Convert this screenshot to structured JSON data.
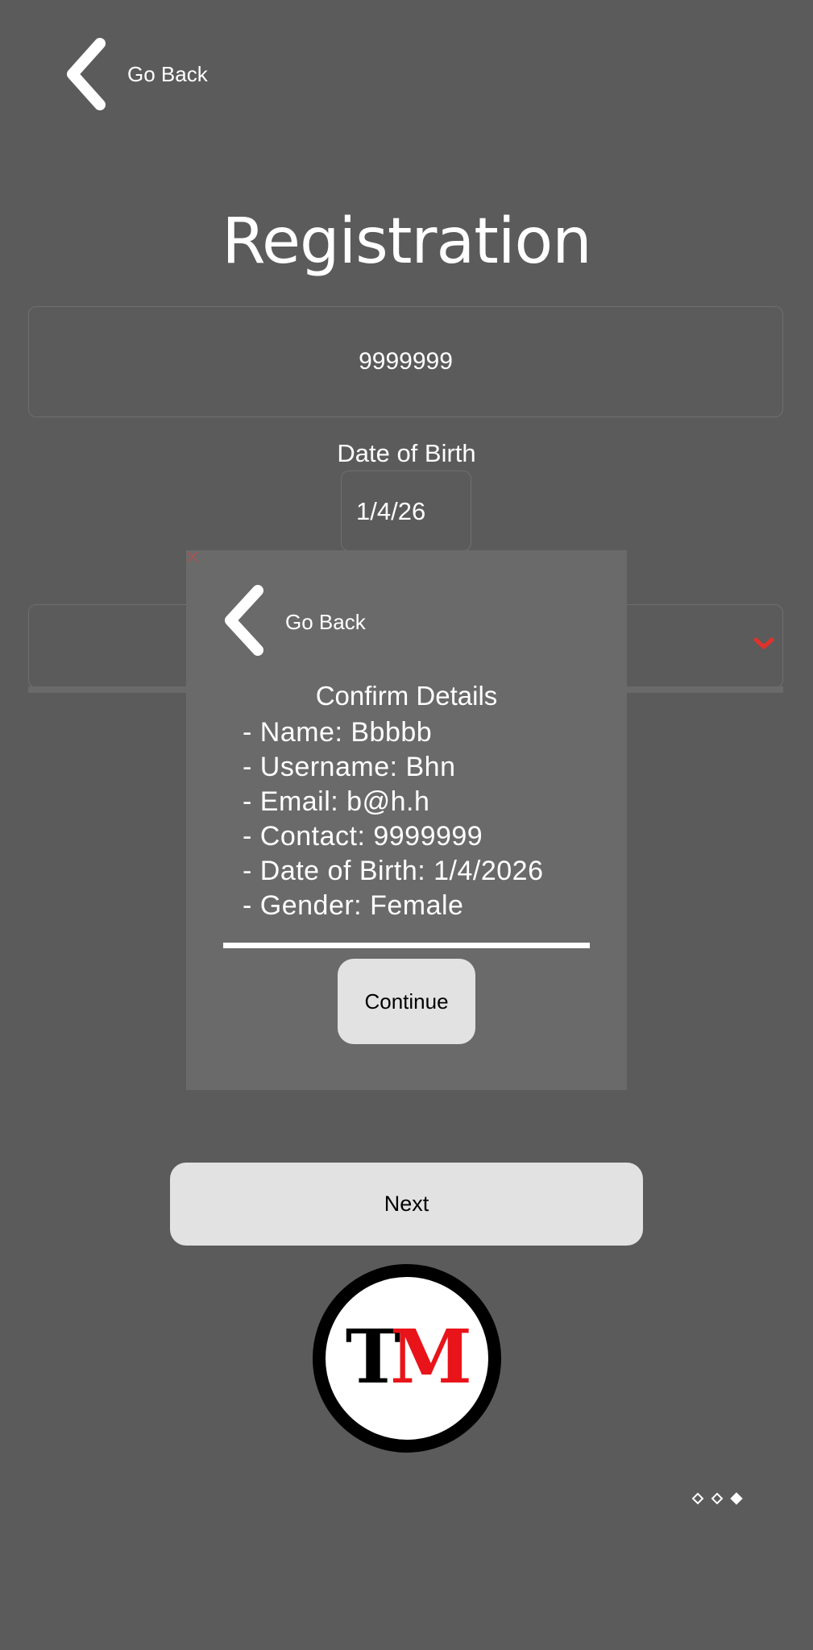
{
  "header": {
    "back_label": "Go Back"
  },
  "page": {
    "title": "Registration"
  },
  "form": {
    "contact_value": "9999999",
    "dob_label": "Date of Birth",
    "dob_value": "1/4/26",
    "gender_value": ""
  },
  "modal": {
    "back_label": "Go Back",
    "title": "Confirm Details",
    "details": [
      "- Name: Bbbbb",
      "- Username: Bhn",
      "- Email: b@h.h",
      "- Contact: 9999999",
      "- Date of Birth: 1/4/2026",
      "- Gender: Female"
    ],
    "continue_label": "Continue"
  },
  "actions": {
    "next_label": "Next"
  },
  "logo": {
    "letter_1": "T",
    "letter_2": "M"
  },
  "pagination": {
    "total": 3,
    "active_index": 2
  },
  "colors": {
    "background": "#5b5b5b",
    "modal_background": "#6a6a6a",
    "button_background": "#e2e2e2",
    "accent_red": "#e0322c",
    "logo_red": "#e8141a"
  },
  "icons": {
    "back": "chevron-left-icon",
    "dropdown": "chevron-down-icon"
  }
}
